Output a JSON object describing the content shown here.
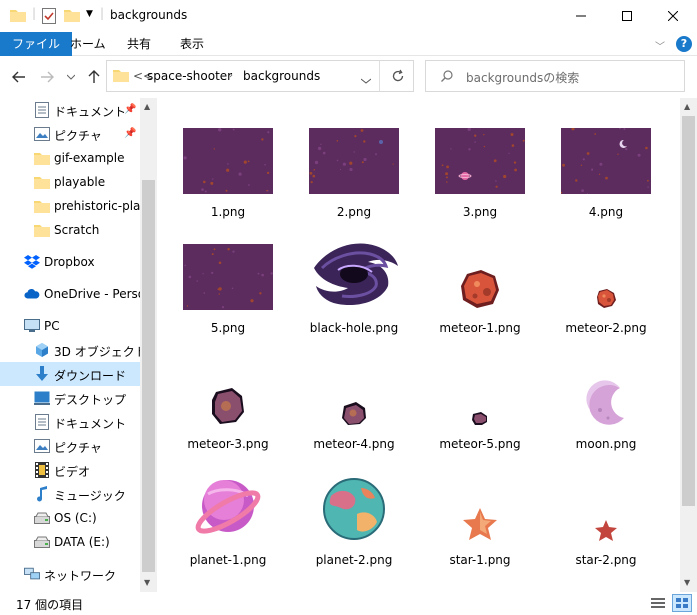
{
  "window": {
    "title": "backgrounds"
  },
  "ribbon": {
    "tabs": [
      {
        "label": "ファイル",
        "active": true
      },
      {
        "label": "ホーム"
      },
      {
        "label": "共有"
      },
      {
        "label": "表示"
      }
    ]
  },
  "address": {
    "overflow": "<<",
    "crumbs": [
      "space-shooter",
      "backgrounds"
    ]
  },
  "search": {
    "placeholder": "backgroundsの検索"
  },
  "nav": {
    "items": [
      {
        "label": "ドキュメント",
        "icon": "documents-icon",
        "pinned": true
      },
      {
        "label": "ピクチャ",
        "icon": "pictures-icon",
        "pinned": true
      },
      {
        "label": "gif-example",
        "icon": "folder-icon"
      },
      {
        "label": "playable",
        "icon": "folder-icon"
      },
      {
        "label": "prehistoric-platf",
        "icon": "folder-icon"
      },
      {
        "label": "Scratch",
        "icon": "folder-icon"
      },
      {
        "label": "Dropbox",
        "icon": "dropbox-icon"
      },
      {
        "label": "OneDrive - Persor",
        "icon": "onedrive-icon"
      },
      {
        "label": "PC",
        "icon": "pc-icon"
      },
      {
        "label": "3D オブジェクト",
        "icon": "3d-objects-icon"
      },
      {
        "label": "ダウンロード",
        "icon": "downloads-icon",
        "selected": true
      },
      {
        "label": "デスクトップ",
        "icon": "desktop-icon"
      },
      {
        "label": "ドキュメント",
        "icon": "documents-icon"
      },
      {
        "label": "ピクチャ",
        "icon": "pictures-icon"
      },
      {
        "label": "ビデオ",
        "icon": "videos-icon"
      },
      {
        "label": "ミュージック",
        "icon": "music-icon"
      },
      {
        "label": "OS (C:)",
        "icon": "drive-icon"
      },
      {
        "label": "DATA (E:)",
        "icon": "drive-icon"
      },
      {
        "label": "ネットワーク",
        "icon": "network-icon"
      }
    ]
  },
  "files": [
    {
      "name": "1.png",
      "kind": "bg"
    },
    {
      "name": "2.png",
      "kind": "bg"
    },
    {
      "name": "3.png",
      "kind": "bg"
    },
    {
      "name": "4.png",
      "kind": "bg"
    },
    {
      "name": "5.png",
      "kind": "bg"
    },
    {
      "name": "black-hole.png",
      "kind": "blackhole"
    },
    {
      "name": "meteor-1.png",
      "kind": "meteor-big"
    },
    {
      "name": "meteor-2.png",
      "kind": "meteor-small"
    },
    {
      "name": "meteor-3.png",
      "kind": "meteor-purple"
    },
    {
      "name": "meteor-4.png",
      "kind": "meteor-purple-small"
    },
    {
      "name": "meteor-5.png",
      "kind": "meteor-tiny"
    },
    {
      "name": "moon.png",
      "kind": "moon"
    },
    {
      "name": "planet-1.png",
      "kind": "planet-ring"
    },
    {
      "name": "planet-2.png",
      "kind": "planet-earth"
    },
    {
      "name": "star-1.png",
      "kind": "star-big"
    },
    {
      "name": "star-2.png",
      "kind": "star-small"
    }
  ],
  "status": {
    "count": "17 個の項目"
  },
  "colors": {
    "accent": "#1979ca",
    "selected": "#cce8ff",
    "space_bg": "#5c2c5e"
  }
}
